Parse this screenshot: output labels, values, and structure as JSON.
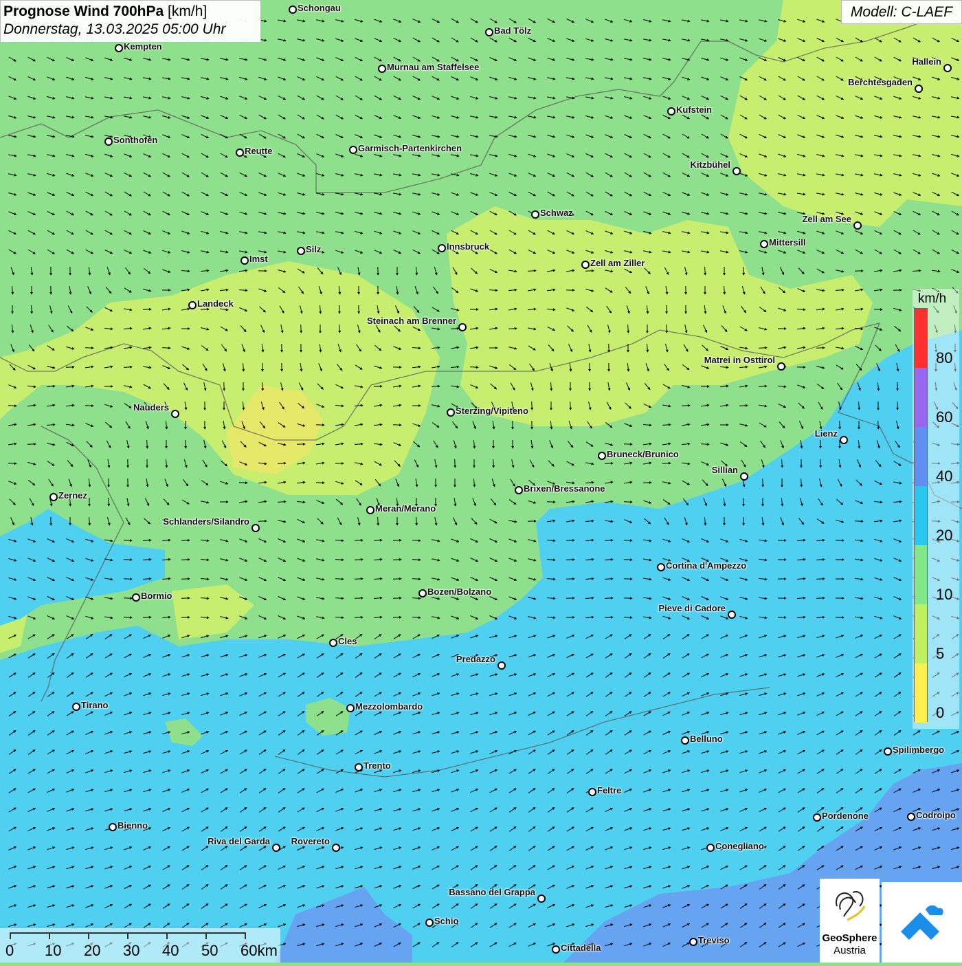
{
  "header": {
    "title": "Prognose Wind 700hPa",
    "unit": "[km/h]",
    "datetime": "Donnerstag, 13.03.2025 05:00 Uhr"
  },
  "model_label": "Modell: C-LAEF",
  "legend": {
    "unit": "km/h",
    "labels": [
      "80",
      "60",
      "40",
      "20",
      "10",
      "5",
      "0"
    ],
    "colors": [
      "#ff3030",
      "#9966ee",
      "#5f8ff0",
      "#29c7ee",
      "#80e888",
      "#c0f060",
      "#fff050"
    ]
  },
  "scale_bar": {
    "labels": [
      "0",
      "10",
      "20",
      "30",
      "40",
      "50",
      "60km"
    ]
  },
  "brand": {
    "name": "GeoSphere",
    "sub": "Austria"
  },
  "map_colors": {
    "green": "#8fe08c",
    "yellow_green": "#c8ee70",
    "yellow": "#e6e86a",
    "cyan": "#50d0f0",
    "blue": "#66a3f0"
  },
  "cities": [
    {
      "name": "Schongau"
    },
    {
      "name": "Bad Tölz"
    },
    {
      "name": "Kempten"
    },
    {
      "name": "Murnau am Staffelsee"
    },
    {
      "name": "Hallein"
    },
    {
      "name": "Berchtesgaden"
    },
    {
      "name": "Kufstein"
    },
    {
      "name": "Sonthofen"
    },
    {
      "name": "Reutte"
    },
    {
      "name": "Garmisch-Partenkirchen"
    },
    {
      "name": "Kitzbühel"
    },
    {
      "name": "Schwaz"
    },
    {
      "name": "Zell am See"
    },
    {
      "name": "Mittersill"
    },
    {
      "name": "Innsbruck"
    },
    {
      "name": "Silz"
    },
    {
      "name": "Imst"
    },
    {
      "name": "Zell am Ziller"
    },
    {
      "name": "Landeck"
    },
    {
      "name": "Steinach am Brenner"
    },
    {
      "name": "Matrei in Osttirol"
    },
    {
      "name": "Nauders"
    },
    {
      "name": "Sterzing/Vipiteno"
    },
    {
      "name": "Lienz"
    },
    {
      "name": "Bruneck/Brunico"
    },
    {
      "name": "Sillian"
    },
    {
      "name": "Brixen/Bressanone"
    },
    {
      "name": "Zernez"
    },
    {
      "name": "Meran/Merano"
    },
    {
      "name": "Schlanders/Silandro"
    },
    {
      "name": "Cortina d'Ampezzo"
    },
    {
      "name": "Bozen/Bolzano"
    },
    {
      "name": "Bormio"
    },
    {
      "name": "Pieve di Cadore"
    },
    {
      "name": "Cles"
    },
    {
      "name": "Predazzo"
    },
    {
      "name": "Tirano"
    },
    {
      "name": "Mezzolombardo"
    },
    {
      "name": "Belluno"
    },
    {
      "name": "Spilimbergo"
    },
    {
      "name": "Trento"
    },
    {
      "name": "Feltre"
    },
    {
      "name": "Pordenone"
    },
    {
      "name": "Codroipo"
    },
    {
      "name": "Bienno"
    },
    {
      "name": "Riva del Garda"
    },
    {
      "name": "Rovereto"
    },
    {
      "name": "Conegliano"
    },
    {
      "name": "Bassano del Grappa"
    },
    {
      "name": "Schio"
    },
    {
      "name": "Treviso"
    },
    {
      "name": "Cittadella"
    }
  ]
}
